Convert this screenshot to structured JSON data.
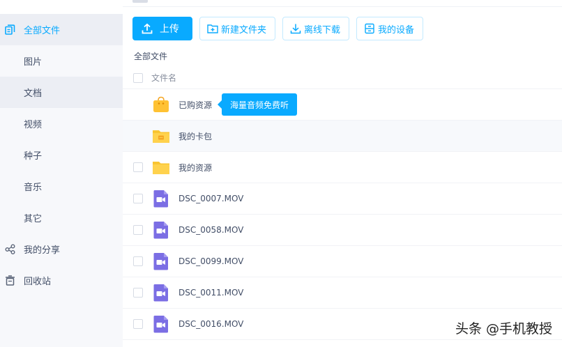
{
  "colors": {
    "accent": "#09aaff",
    "sidebar_bg": "#f7f8fb",
    "active_bg": "#eceef4",
    "text": "#424e67",
    "folder": "#ffd24d",
    "video": "#7b6ee4",
    "bag": "#ffc233"
  },
  "sidebar": {
    "items": [
      {
        "label": "全部文件",
        "icon": "all-files-icon"
      },
      {
        "label": "图片"
      },
      {
        "label": "文档"
      },
      {
        "label": "视频"
      },
      {
        "label": "种子"
      },
      {
        "label": "音乐"
      },
      {
        "label": "其它"
      },
      {
        "label": "我的分享",
        "icon": "share-icon"
      },
      {
        "label": "回收站",
        "icon": "recycle-bin-icon"
      }
    ]
  },
  "toolbar": {
    "upload": "上传",
    "new_folder": "新建文件夹",
    "offline_download": "离线下载",
    "my_devices": "我的设备"
  },
  "breadcrumb": "全部文件",
  "list": {
    "header": "文件名",
    "rows": [
      {
        "name": "已购资源",
        "icon": "shopping-bag-icon"
      },
      {
        "name": "我的卡包",
        "icon": "card-folder-icon"
      },
      {
        "name": "我的资源",
        "icon": "folder-icon"
      },
      {
        "name": "DSC_0007.MOV",
        "icon": "video-file-icon"
      },
      {
        "name": "DSC_0058.MOV",
        "icon": "video-file-icon"
      },
      {
        "name": "DSC_0099.MOV",
        "icon": "video-file-icon"
      },
      {
        "name": "DSC_0011.MOV",
        "icon": "video-file-icon"
      },
      {
        "name": "DSC_0016.MOV",
        "icon": "video-file-icon"
      }
    ]
  },
  "tooltip": "海量音频免费听",
  "watermark": "头条 @手机教授"
}
